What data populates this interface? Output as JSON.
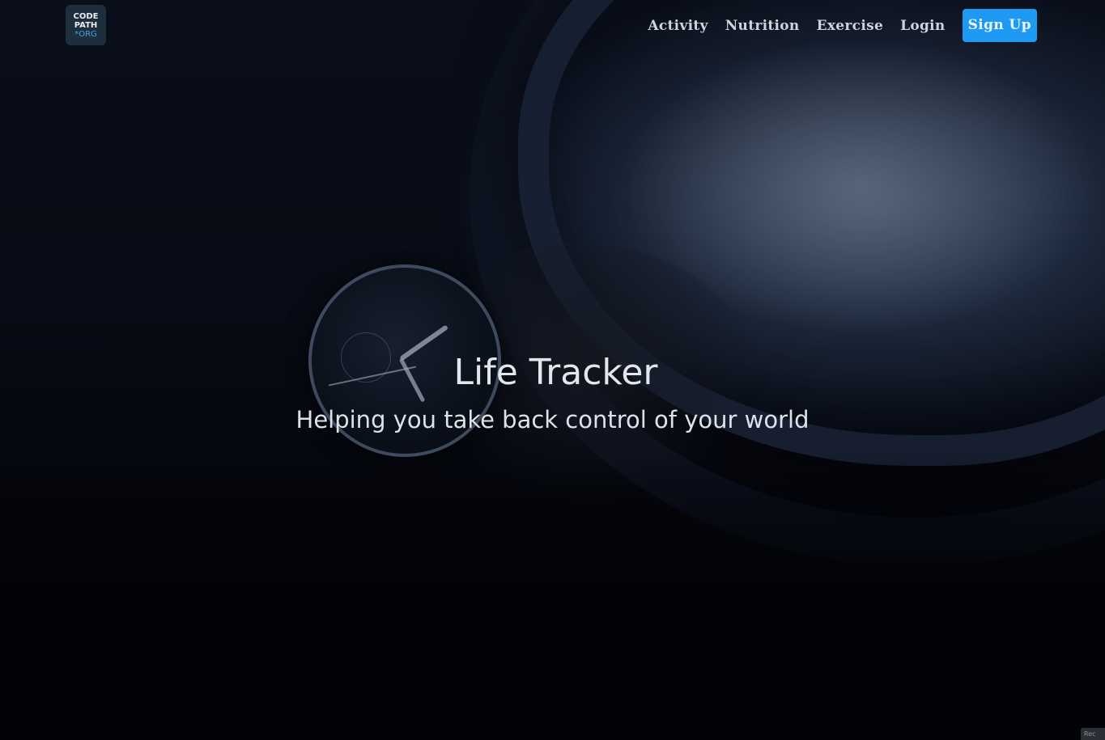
{
  "navbar": {
    "logo": {
      "line1": "CODE",
      "line2": "PATH",
      "line3": "*ORG"
    },
    "links": [
      {
        "label": "Activity"
      },
      {
        "label": "Nutrition"
      },
      {
        "label": "Exercise"
      },
      {
        "label": "Login"
      }
    ],
    "signup_label": "Sign Up"
  },
  "hero": {
    "title": "Life Tracker",
    "subtitle": "Helping you take back control of your world"
  },
  "corner_widget": {
    "label": "Rec"
  },
  "colors": {
    "signup_button": "#1e9af2",
    "logo_background": "#1f2e3d",
    "logo_accent": "#3aa3e3",
    "nav_text": "#cdd3da"
  }
}
